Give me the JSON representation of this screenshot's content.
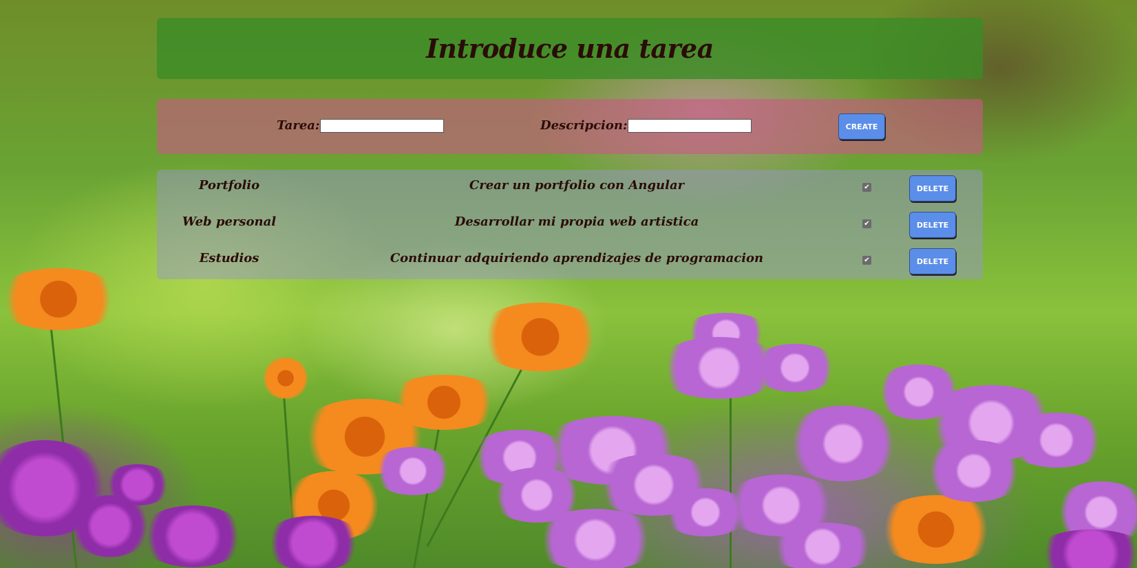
{
  "header": {
    "title": "Introduce una tarea"
  },
  "form": {
    "task_label": "Tarea:",
    "task_value": "",
    "description_label": "Descripcion:",
    "description_value": "",
    "create_label": "CREATE"
  },
  "tasks": [
    {
      "title": "Portfolio",
      "description": "Crear un portfolio con Angular",
      "checked": true,
      "delete_label": "DELETE"
    },
    {
      "title": "Web personal",
      "description": "Desarrollar mi propia web artistica",
      "checked": true,
      "delete_label": "DELETE"
    },
    {
      "title": "Estudios",
      "description": "Continuar adquiriendo aprendizajes de programacion",
      "checked": true,
      "delete_label": "DELETE"
    }
  ],
  "colors": {
    "title_panel": "#3a8c26",
    "form_panel": "#c85a82",
    "list_panel": "#9696c8",
    "button": "#5b8ee8",
    "text": "#2a0c08"
  },
  "icons": {
    "check": "check-icon"
  }
}
